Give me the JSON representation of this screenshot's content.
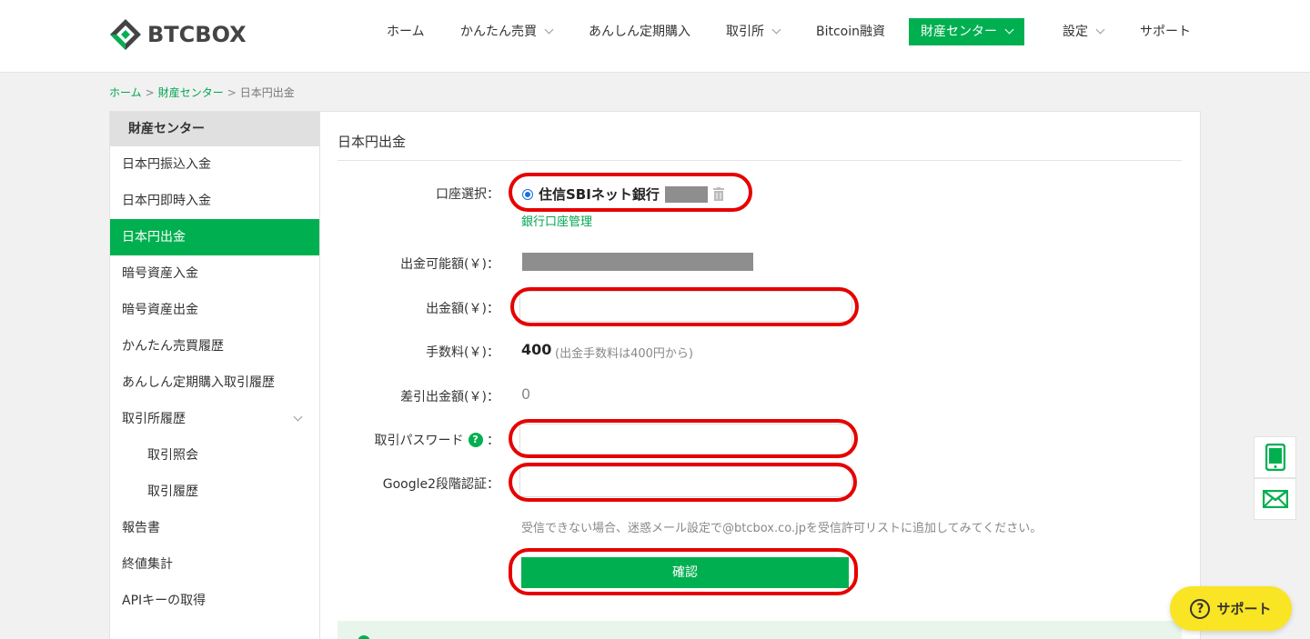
{
  "header": {
    "logo_text": "BTCBOX",
    "nav": [
      {
        "label": "ホーム",
        "has_menu": false
      },
      {
        "label": "かんたん売買",
        "has_menu": true
      },
      {
        "label": "あんしん定期購入",
        "has_menu": false
      },
      {
        "label": "取引所",
        "has_menu": true
      },
      {
        "label": "Bitcoin融資",
        "has_menu": false
      },
      {
        "label": "財産センター",
        "has_menu": true,
        "active": true
      },
      {
        "label": "設定",
        "has_menu": true
      },
      {
        "label": "サポート",
        "has_menu": false
      }
    ]
  },
  "breadcrumb": {
    "home": "ホーム",
    "section": "財産センター",
    "current": "日本円出金",
    "separator": ">"
  },
  "sidebar": {
    "title": "財産センター",
    "items": [
      {
        "label": "日本円振込入金"
      },
      {
        "label": "日本円即時入金"
      },
      {
        "label": "日本円出金",
        "active": true
      },
      {
        "label": "暗号資産入金"
      },
      {
        "label": "暗号資産出金"
      },
      {
        "label": "かんたん売買履歴"
      },
      {
        "label": "あんしん定期購入取引履歴"
      },
      {
        "label": "取引所履歴",
        "expandable": true
      },
      {
        "label": "取引照会",
        "sub": true
      },
      {
        "label": "取引履歴",
        "sub": true
      },
      {
        "label": "報告書"
      },
      {
        "label": "終値集計"
      },
      {
        "label": "APIキーの取得"
      }
    ]
  },
  "main": {
    "title": "日本円出金",
    "account_label": "口座選択：",
    "bank_name": "住信SBIネット銀行",
    "bank_manage_link": "銀行口座管理",
    "available_label": "出金可能額(￥)：",
    "amount_label": "出金額(￥)：",
    "fee_label": "手数料(￥)：",
    "fee_value": "400",
    "fee_note": "(出金手数料は400円から)",
    "net_label": "差引出金額(￥)：",
    "net_value": "0",
    "password_label": "取引パスワード",
    "password_colon": "：",
    "help_icon_text": "?",
    "google_label": "Google2段階認証：",
    "hint": "受信できない場合、迷惑メール設定で@btcbox.co.jpを受信許可リストに追加してみてください。",
    "confirm_button": "確認",
    "amount_value": "",
    "password_value": "",
    "google_value": ""
  },
  "support_button": {
    "label": "サポート",
    "icon_text": "?"
  },
  "colors": {
    "brand_green": "#00b050",
    "link_green": "#00a651",
    "highlight_red": "#e60000",
    "support_yellow": "#f9e524"
  }
}
